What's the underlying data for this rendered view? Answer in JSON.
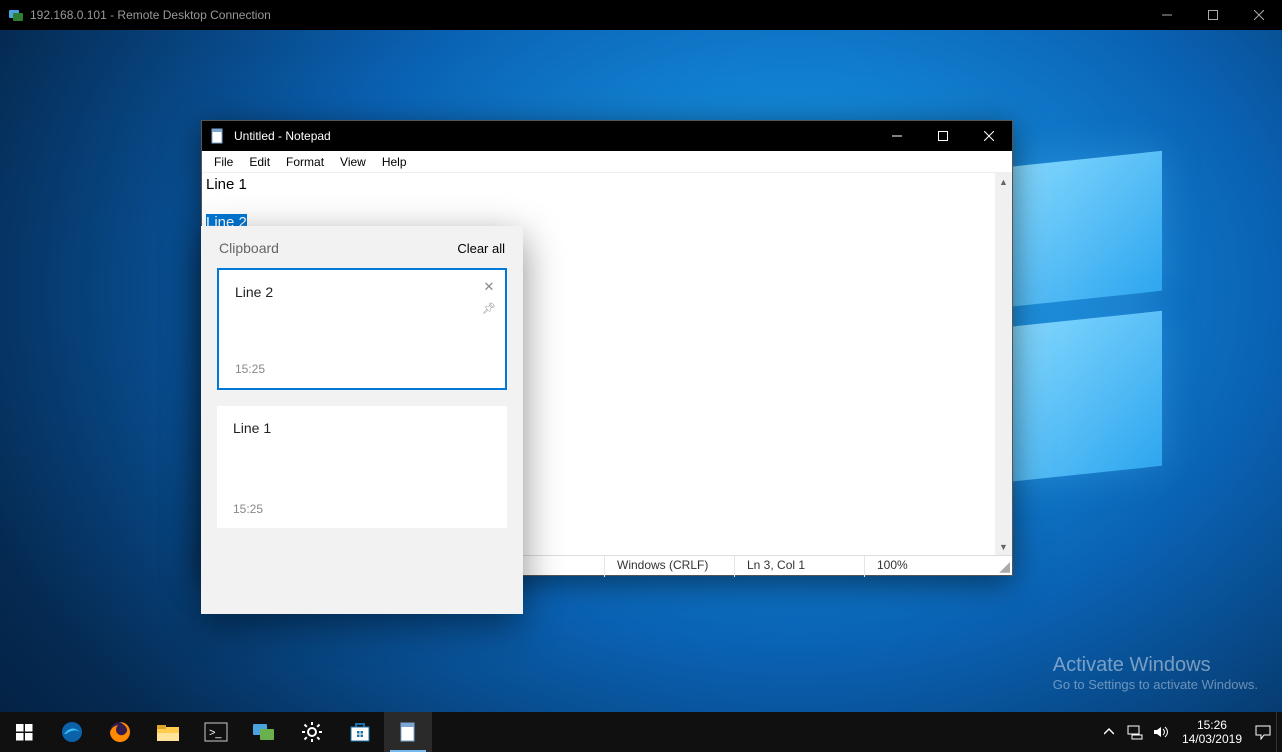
{
  "rdp": {
    "title": "192.168.0.101 - Remote Desktop Connection"
  },
  "notepad": {
    "title": "Untitled - Notepad",
    "menu": {
      "file": "File",
      "edit": "Edit",
      "format": "Format",
      "view": "View",
      "help": "Help"
    },
    "content": {
      "line1": "Line 1",
      "blank": "",
      "line2_selected": "Line 2"
    },
    "status": {
      "encoding": "Windows (CRLF)",
      "pos": "Ln 3, Col 1",
      "zoom": "100%"
    }
  },
  "clipboard": {
    "title": "Clipboard",
    "clear_all": "Clear all",
    "items": [
      {
        "text": "Line 2",
        "time": "15:25",
        "active": true
      },
      {
        "text": "Line 1",
        "time": "15:25",
        "active": false
      }
    ]
  },
  "watermark": {
    "line1": "Activate Windows",
    "line2": "Go to Settings to activate Windows."
  },
  "tray": {
    "time": "15:26",
    "date": "14/03/2019"
  }
}
